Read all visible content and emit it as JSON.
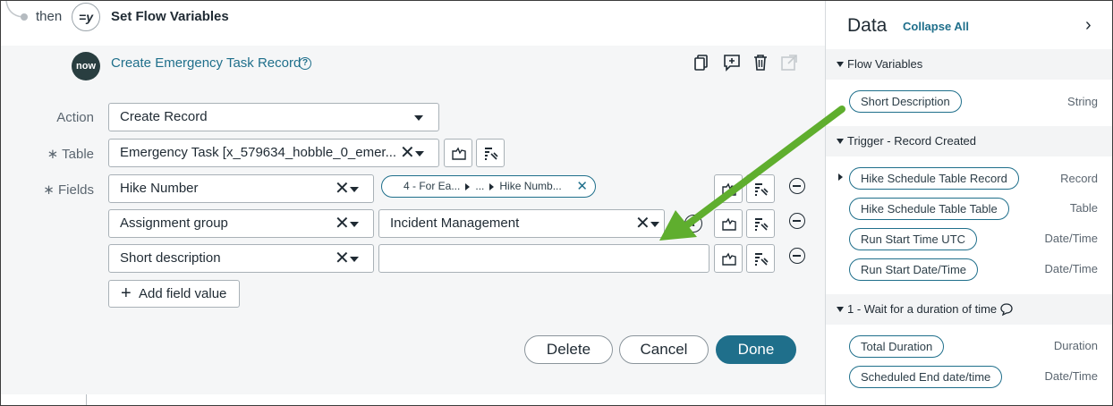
{
  "step": {
    "prefix": "then",
    "icon_text": "=y",
    "title": "Set Flow Variables"
  },
  "action": {
    "logo_text": "now",
    "title": "Create Emergency Task Record",
    "help": "?"
  },
  "toolbar": {
    "icons": [
      "copy-icon",
      "add-comment-icon",
      "delete-icon",
      "open-external-icon"
    ]
  },
  "form": {
    "action_label": "Action",
    "action_value": "Create Record",
    "table_label": "Table",
    "table_value": "Emergency Task [x_579634_hobble_0_emer...",
    "fields_label": "Fields",
    "rows": [
      {
        "name": "Hike Number",
        "pill": {
          "part1": "4 - For Ea...",
          "part2": "...",
          "part3": "Hike Numb..."
        }
      },
      {
        "name": "Assignment group",
        "value": "Incident Management"
      },
      {
        "name": "Short description",
        "value": ""
      }
    ],
    "required_mark": "∗",
    "add_label": "Add field value"
  },
  "buttons": {
    "delete": "Delete",
    "cancel": "Cancel",
    "done": "Done"
  },
  "data_panel": {
    "title": "Data",
    "collapse_all": "Collapse All",
    "sections": [
      {
        "title": "Flow Variables",
        "items": [
          {
            "label": "Short Description",
            "type": "String"
          }
        ]
      },
      {
        "title": "Trigger - Record Created",
        "items": [
          {
            "label": "Hike Schedule Table Record",
            "type": "Record"
          },
          {
            "label": "Hike Schedule Table Table",
            "type": "Table"
          },
          {
            "label": "Run Start Time UTC",
            "type": "Date/Time"
          },
          {
            "label": "Run Start Date/Time",
            "type": "Date/Time"
          }
        ]
      },
      {
        "title": "1 - Wait for a duration of time",
        "items": [
          {
            "label": "Total Duration",
            "type": "Duration"
          },
          {
            "label": "Scheduled End date/time",
            "type": "Date/Time"
          }
        ]
      }
    ]
  },
  "colors": {
    "accent": "#1f6f8b",
    "arrow": "#5fae2e",
    "panel_bg": "#f5f6f7"
  }
}
